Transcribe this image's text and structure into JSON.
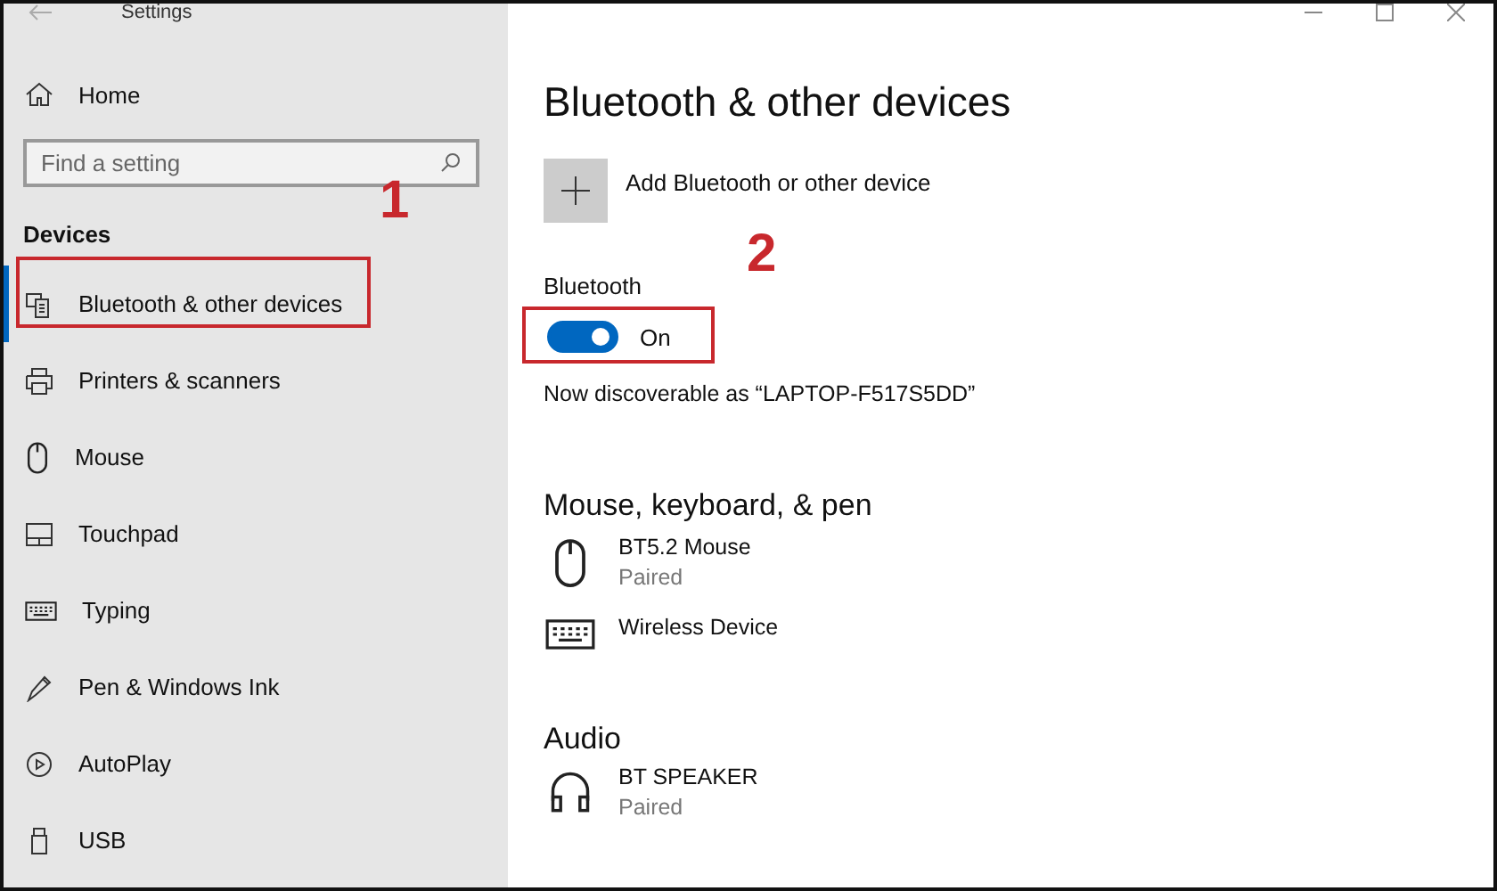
{
  "window": {
    "title": "Settings"
  },
  "sidebar": {
    "home": "Home",
    "search": {
      "placeholder": "Find a setting"
    },
    "section": "Devices",
    "items": [
      {
        "label": "Bluetooth & other devices",
        "kind": "bluetooth",
        "selected": true
      },
      {
        "label": "Printers & scanners",
        "kind": "printer",
        "selected": false
      },
      {
        "label": "Mouse",
        "kind": "mouse",
        "selected": false
      },
      {
        "label": "Touchpad",
        "kind": "touchpad",
        "selected": false
      },
      {
        "label": "Typing",
        "kind": "keyboard",
        "selected": false
      },
      {
        "label": "Pen & Windows Ink",
        "kind": "pen",
        "selected": false
      },
      {
        "label": "AutoPlay",
        "kind": "autoplay",
        "selected": false
      },
      {
        "label": "USB",
        "kind": "usb",
        "selected": false
      }
    ]
  },
  "main": {
    "title": "Bluetooth & other devices",
    "add_device": "Add Bluetooth or other device",
    "bluetooth": {
      "label": "Bluetooth",
      "on": true,
      "state": "On"
    },
    "discoverable": "Now discoverable as “LAPTOP-F517S5DD”",
    "groups": [
      {
        "heading": "Mouse, keyboard, & pen",
        "devices": [
          {
            "name": "BT5.2 Mouse",
            "status": "Paired",
            "kind": "mouse"
          },
          {
            "name": "Wireless Device",
            "kind": "keyboard"
          }
        ]
      },
      {
        "heading": "Audio",
        "devices": [
          {
            "name": "BT SPEAKER",
            "status": "Paired",
            "kind": "headphones"
          }
        ]
      }
    ]
  },
  "annotations": [
    {
      "label": "1"
    },
    {
      "label": "2"
    }
  ]
}
